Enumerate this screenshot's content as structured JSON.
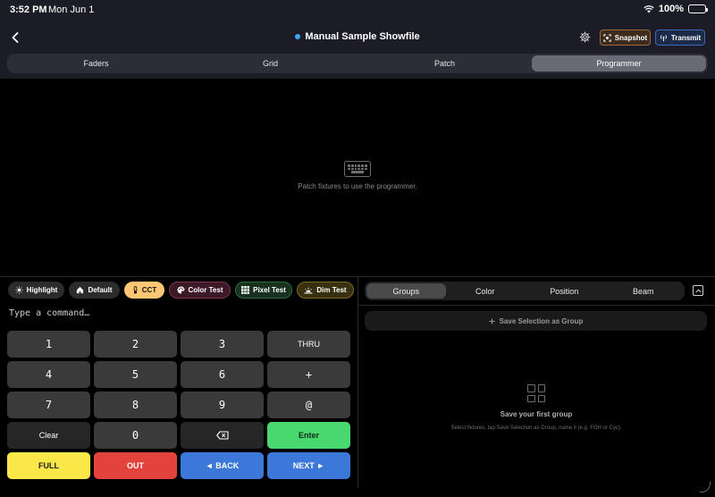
{
  "status": {
    "time": "3:52 PM",
    "date": "Mon Jun 1",
    "battery": "100%"
  },
  "header": {
    "title": "Manual Sample Showfile",
    "snapshot_label": "Snapshot",
    "transmit_label": "Transmit"
  },
  "tabs": [
    {
      "label": "Faders",
      "active": false
    },
    {
      "label": "Grid",
      "active": false
    },
    {
      "label": "Patch",
      "active": false
    },
    {
      "label": "Programmer",
      "active": true
    }
  ],
  "empty_state": {
    "message": "Patch fixtures to use the programmer."
  },
  "chips": {
    "highlight": "Highlight",
    "default": "Default",
    "cct": "CCT",
    "color_test": "Color Test",
    "pixel_test": "Pixel Test",
    "dim_test": "Dim Test"
  },
  "command": {
    "placeholder": "Type a command…"
  },
  "keypad": {
    "k1": "1",
    "k2": "2",
    "k3": "3",
    "thru": "THRU",
    "k4": "4",
    "k5": "5",
    "k6": "6",
    "plus": "+",
    "k7": "7",
    "k8": "8",
    "k9": "9",
    "at": "@",
    "clear": "Clear",
    "k0": "0",
    "enter": "Enter",
    "full": "FULL",
    "out": "OUT",
    "back": "◄ BACK",
    "next": "NEXT ►"
  },
  "right_tabs": [
    {
      "label": "Groups",
      "active": true
    },
    {
      "label": "Color",
      "active": false
    },
    {
      "label": "Position",
      "active": false
    },
    {
      "label": "Beam",
      "active": false
    }
  ],
  "groups": {
    "save_selection": "Save Selection as Group",
    "first_title": "Save your first group",
    "first_sub": "Select fixtures, tap Save Selection as Group, name it (e.g. FOH or Cyc)."
  },
  "colors": {
    "accent_blue": "#3b78d8",
    "enter_green": "#48d86f",
    "full_yellow": "#f9e848",
    "out_red": "#e2433c",
    "cct_orange": "#ffc774"
  }
}
